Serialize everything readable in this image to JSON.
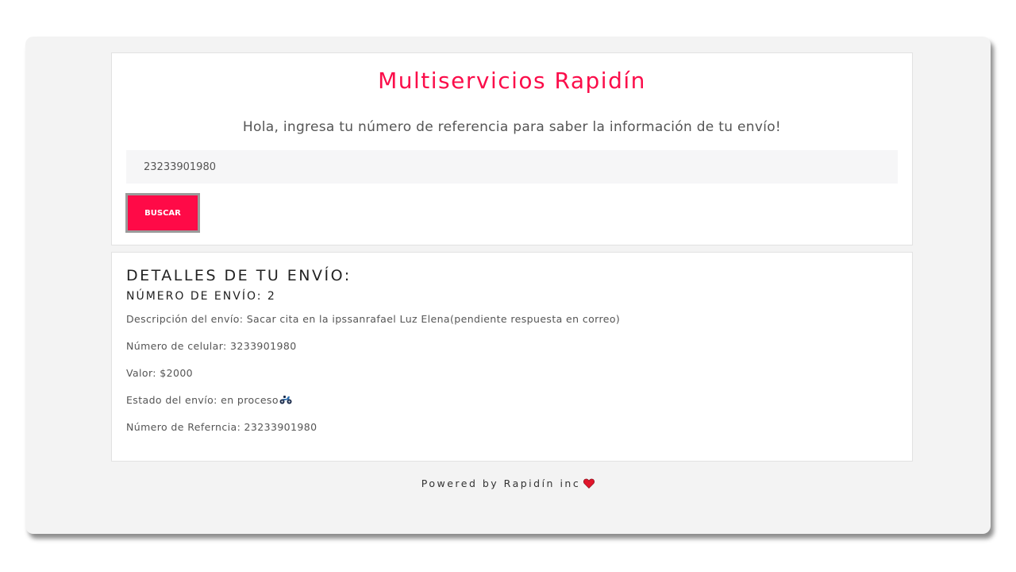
{
  "app": {
    "title": "Multiservicios Rapidín",
    "intro": "Hola, ingresa tu número de referencia para saber la información de tu envío!"
  },
  "search": {
    "value": "23233901980",
    "button_label": "BUSCAR"
  },
  "details": {
    "heading": "DETALLES DE TU ENVÍO:",
    "shipment_number": "NÚMERO DE ENVÍO: 2",
    "description": "Descripción del envío: Sacar cita en la ipssanrafael Luz Elena(pendiente respuesta en correo)",
    "phone": "Número de celular: 3233901980",
    "value": "Valor: $2000",
    "status": "Estado del envío: en proceso",
    "status_icon": "motorcycle-icon",
    "reference": "Número de Referncia: 23233901980"
  },
  "footer": {
    "text": "Powered by Rapidín inc",
    "icon": "heart-icon"
  },
  "colors": {
    "accent": "#ff0a47",
    "title": "#fb0d4a",
    "background": "#f3f3f3",
    "heart": "#e0162b"
  }
}
